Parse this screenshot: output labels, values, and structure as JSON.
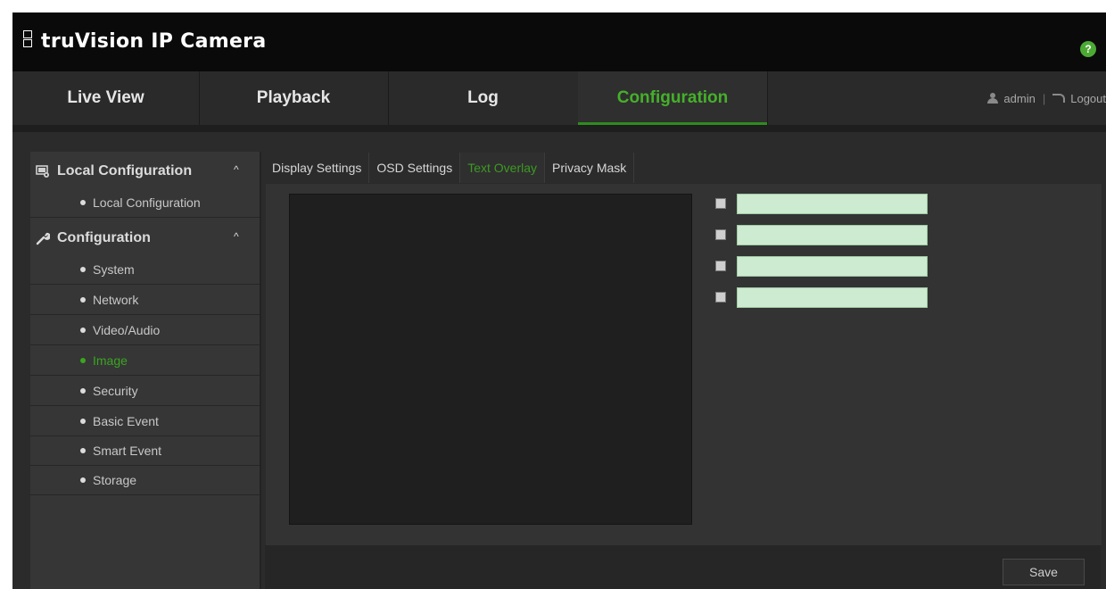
{
  "app": {
    "brand": "truVision IP Camera",
    "help_label": "?"
  },
  "nav": {
    "tabs": [
      {
        "label": "Live View"
      },
      {
        "label": "Playback"
      },
      {
        "label": "Log"
      },
      {
        "label": "Configuration",
        "active": true
      }
    ],
    "user": "admin",
    "separator": "|",
    "logout": "Logout"
  },
  "sidebar": {
    "sections": [
      {
        "title": "Local Configuration",
        "icon": "local-config-icon",
        "items": [
          {
            "label": "Local Configuration"
          }
        ]
      },
      {
        "title": "Configuration",
        "icon": "wrench-icon",
        "items": [
          {
            "label": "System"
          },
          {
            "label": "Network"
          },
          {
            "label": "Video/Audio"
          },
          {
            "label": "Image",
            "active": true
          },
          {
            "label": "Security"
          },
          {
            "label": "Basic Event"
          },
          {
            "label": "Smart Event"
          },
          {
            "label": "Storage"
          }
        ]
      }
    ],
    "caret": "^"
  },
  "content": {
    "tabs": [
      {
        "label": "Display Settings"
      },
      {
        "label": "OSD Settings"
      },
      {
        "label": "Text Overlay",
        "active": true
      },
      {
        "label": "Privacy Mask"
      }
    ],
    "overlays": [
      {
        "checked": false,
        "value": ""
      },
      {
        "checked": false,
        "value": ""
      },
      {
        "checked": false,
        "value": ""
      },
      {
        "checked": false,
        "value": ""
      }
    ],
    "save_label": "Save"
  },
  "colors": {
    "accent": "#45b02a",
    "background": "#2b2b2b",
    "input_bg": "#cdebd0"
  }
}
